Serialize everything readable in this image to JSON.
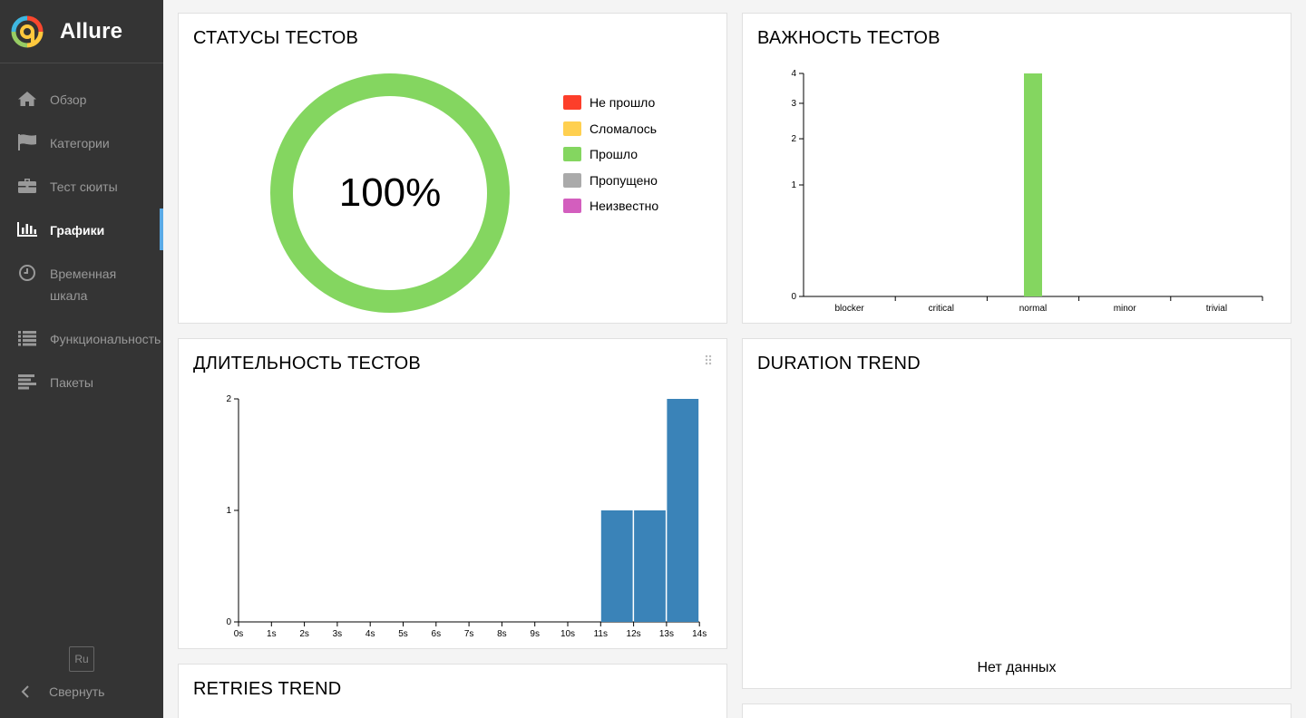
{
  "app": {
    "name": "Allure"
  },
  "sidebar": {
    "items": [
      {
        "label": "Обзор",
        "icon": "home-icon"
      },
      {
        "label": "Категории",
        "icon": "flag-icon"
      },
      {
        "label": "Тест сюиты",
        "icon": "briefcase-icon"
      },
      {
        "label": "Графики",
        "icon": "bar-chart-icon",
        "active": true
      },
      {
        "label": "Временная шкала",
        "icon": "clock-icon"
      },
      {
        "label": "Функциональность",
        "icon": "list-icon"
      },
      {
        "label": "Пакеты",
        "icon": "align-left-icon"
      }
    ],
    "language": "Ru",
    "collapse_label": "Свернуть"
  },
  "widgets": {
    "status": {
      "title": "СТАТУСЫ ТЕСТОВ",
      "percent": "100%",
      "legend": [
        {
          "label": "Не прошло",
          "color": "#fd3e2a"
        },
        {
          "label": "Сломалось",
          "color": "#ffd050"
        },
        {
          "label": "Прошло",
          "color": "#84d660"
        },
        {
          "label": "Пропущено",
          "color": "#aaaaaa"
        },
        {
          "label": "Неизвестно",
          "color": "#d35ebe"
        }
      ]
    },
    "severity": {
      "title": "ВАЖНОСТЬ ТЕСТОВ"
    },
    "duration": {
      "title": "ДЛИТЕЛЬНОСТЬ ТЕСТОВ"
    },
    "duration_trend": {
      "title": "DURATION TREND",
      "empty_text": "Нет данных"
    },
    "retries_trend": {
      "title": "RETRIES TREND"
    }
  },
  "chart_data": [
    {
      "type": "pie",
      "title": "СТАТУСЫ ТЕСТОВ",
      "categories": [
        "Не прошло",
        "Сломалось",
        "Прошло",
        "Пропущено",
        "Неизвестно"
      ],
      "values": [
        0,
        0,
        1,
        0,
        0
      ],
      "colors": [
        "#fd3e2a",
        "#ffd050",
        "#84d660",
        "#aaaaaa",
        "#d35ebe"
      ],
      "center_label": "100%",
      "legend": "right"
    },
    {
      "type": "bar",
      "title": "ВАЖНОСТЬ ТЕСТОВ",
      "categories": [
        "blocker",
        "critical",
        "normal",
        "minor",
        "trivial"
      ],
      "values": [
        0,
        0,
        4,
        0,
        0
      ],
      "yticks": [
        0,
        1,
        2,
        3,
        4
      ],
      "ylim": [
        0,
        4
      ],
      "yscale": "sqrt",
      "color": "#84d660"
    },
    {
      "type": "bar",
      "title": "ДЛИТЕЛЬНОСТЬ ТЕСТОВ",
      "x_ticks": [
        "0s",
        "1s",
        "2s",
        "3s",
        "4s",
        "5s",
        "6s",
        "7s",
        "8s",
        "9s",
        "10s",
        "11s",
        "12s",
        "13s",
        "14s"
      ],
      "bins": [
        {
          "from": 11,
          "to": 12,
          "value": 1
        },
        {
          "from": 12,
          "to": 13,
          "value": 1
        },
        {
          "from": 13,
          "to": 14,
          "value": 2
        }
      ],
      "yticks": [
        0,
        1,
        2
      ],
      "ylim": [
        0,
        2
      ],
      "color": "#3a83b8"
    }
  ]
}
